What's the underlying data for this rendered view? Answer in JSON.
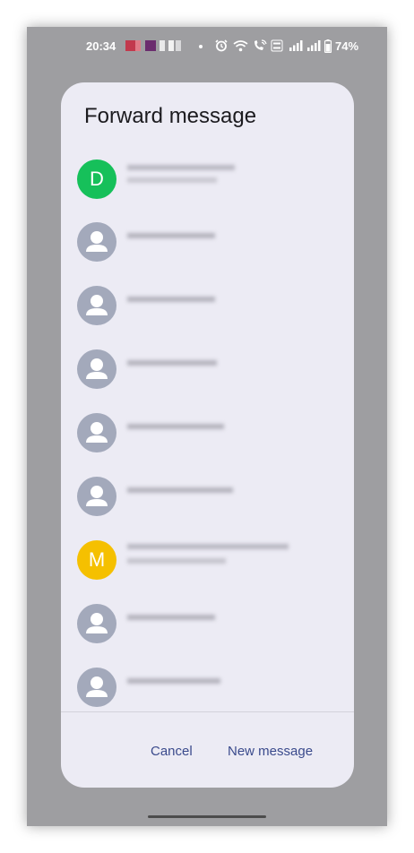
{
  "status_bar": {
    "time": "20:34",
    "battery": "74%"
  },
  "dialog": {
    "title": "Forward message",
    "cancel_label": "Cancel",
    "new_message_label": "New message"
  },
  "contacts": [
    {
      "avatar": "letter",
      "letter": "D",
      "color": "#16c05a",
      "name": "[blurred]"
    },
    {
      "avatar": "person-icon",
      "name": "[blurred]"
    },
    {
      "avatar": "person-icon",
      "name": "[blurred]"
    },
    {
      "avatar": "person-icon",
      "name": "[blurred]"
    },
    {
      "avatar": "person-icon",
      "name": "[blurred]"
    },
    {
      "avatar": "person-icon",
      "name": "[blurred]"
    },
    {
      "avatar": "letter",
      "letter": "M",
      "color": "#f5c000",
      "name": "[blurred]"
    },
    {
      "avatar": "person-icon",
      "name": "[blurred]"
    },
    {
      "avatar": "person-icon",
      "name": "[blurred]"
    }
  ],
  "colors": {
    "dialog_bg": "#ecebf4",
    "button_text": "#3a4a8c",
    "generic_avatar": "#a3a9bb"
  }
}
